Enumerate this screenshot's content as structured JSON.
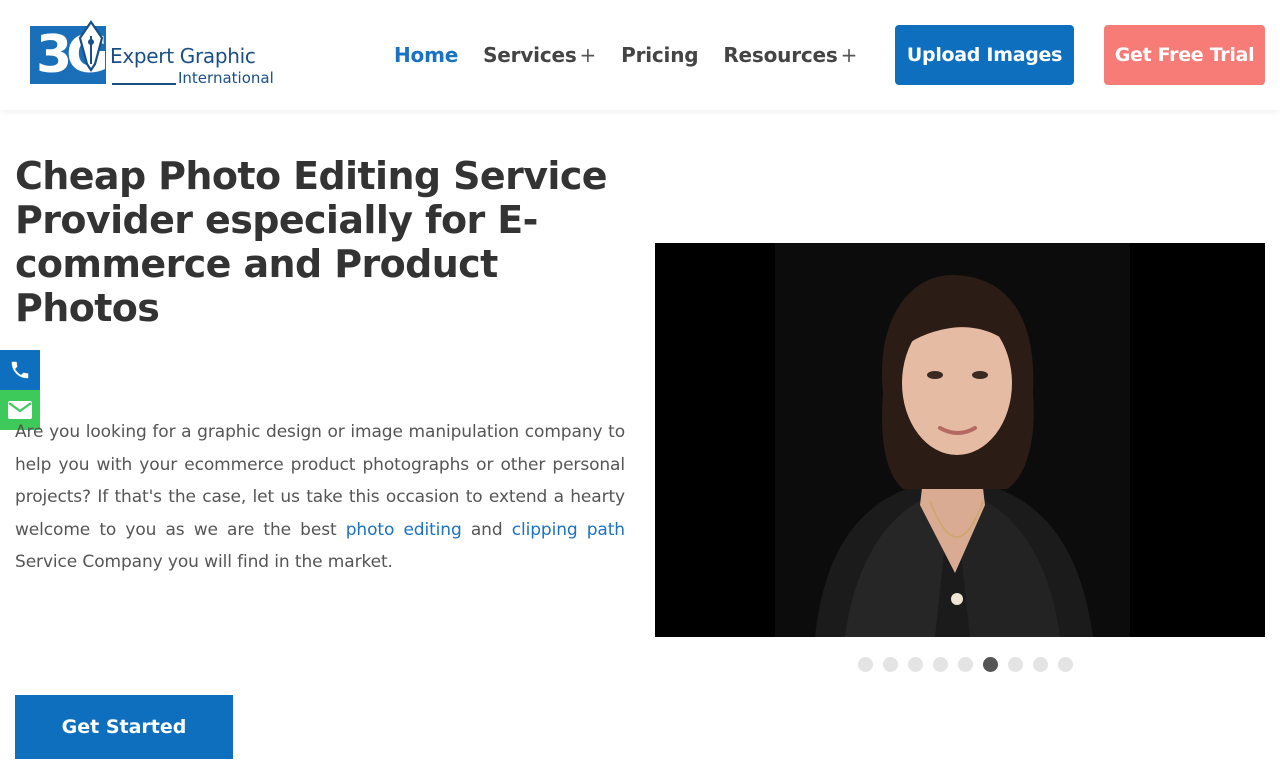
{
  "brand": {
    "logo_letters": "3G",
    "name": "Expert Graphic",
    "sub": "International"
  },
  "nav": {
    "items": [
      {
        "label": "Home",
        "active": true,
        "has_submenu": false
      },
      {
        "label": "Services",
        "active": false,
        "has_submenu": true
      },
      {
        "label": "Pricing",
        "active": false,
        "has_submenu": false
      },
      {
        "label": "Resources",
        "active": false,
        "has_submenu": true
      }
    ],
    "submenu_glyph": "+"
  },
  "header_buttons": {
    "upload": "Upload Images",
    "trial": "Get Free Trial"
  },
  "hero": {
    "title": "Cheap Photo Editing Service Provider especially for E-commerce and Product Photos",
    "text_1": "Are you looking for a graphic design or image manipulation company to help you with your ecommerce product photographs or other personal projects? If that's the case, let us take this occasion to extend a hearty welcome to you as we are the best ",
    "link_1": "photo editing",
    "text_2": " and ",
    "link_2": "clipping path",
    "text_3": " Service Company you will find in the market.",
    "cta": "Get Started"
  },
  "side_contacts": {
    "phone_icon": "phone-icon",
    "mail_icon": "envelope-icon"
  },
  "slider": {
    "slide_count": 9,
    "active_index": 5
  },
  "colors": {
    "primary": "#0f6fbf",
    "accent": "#f77b76",
    "nav_active": "#1a73c2",
    "mail_tab": "#3ec95b",
    "heading": "#333333"
  }
}
